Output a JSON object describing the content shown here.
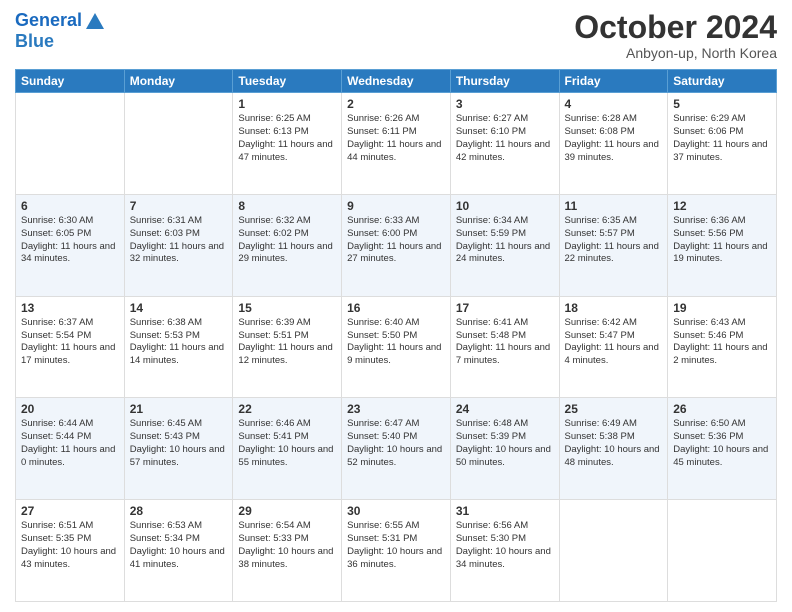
{
  "logo": {
    "line1": "General",
    "line2": "Blue"
  },
  "title": "October 2024",
  "subtitle": "Anbyon-up, North Korea",
  "days_of_week": [
    "Sunday",
    "Monday",
    "Tuesday",
    "Wednesday",
    "Thursday",
    "Friday",
    "Saturday"
  ],
  "weeks": [
    [
      {
        "day": "",
        "info": ""
      },
      {
        "day": "",
        "info": ""
      },
      {
        "day": "1",
        "info": "Sunrise: 6:25 AM\nSunset: 6:13 PM\nDaylight: 11 hours and 47 minutes."
      },
      {
        "day": "2",
        "info": "Sunrise: 6:26 AM\nSunset: 6:11 PM\nDaylight: 11 hours and 44 minutes."
      },
      {
        "day": "3",
        "info": "Sunrise: 6:27 AM\nSunset: 6:10 PM\nDaylight: 11 hours and 42 minutes."
      },
      {
        "day": "4",
        "info": "Sunrise: 6:28 AM\nSunset: 6:08 PM\nDaylight: 11 hours and 39 minutes."
      },
      {
        "day": "5",
        "info": "Sunrise: 6:29 AM\nSunset: 6:06 PM\nDaylight: 11 hours and 37 minutes."
      }
    ],
    [
      {
        "day": "6",
        "info": "Sunrise: 6:30 AM\nSunset: 6:05 PM\nDaylight: 11 hours and 34 minutes."
      },
      {
        "day": "7",
        "info": "Sunrise: 6:31 AM\nSunset: 6:03 PM\nDaylight: 11 hours and 32 minutes."
      },
      {
        "day": "8",
        "info": "Sunrise: 6:32 AM\nSunset: 6:02 PM\nDaylight: 11 hours and 29 minutes."
      },
      {
        "day": "9",
        "info": "Sunrise: 6:33 AM\nSunset: 6:00 PM\nDaylight: 11 hours and 27 minutes."
      },
      {
        "day": "10",
        "info": "Sunrise: 6:34 AM\nSunset: 5:59 PM\nDaylight: 11 hours and 24 minutes."
      },
      {
        "day": "11",
        "info": "Sunrise: 6:35 AM\nSunset: 5:57 PM\nDaylight: 11 hours and 22 minutes."
      },
      {
        "day": "12",
        "info": "Sunrise: 6:36 AM\nSunset: 5:56 PM\nDaylight: 11 hours and 19 minutes."
      }
    ],
    [
      {
        "day": "13",
        "info": "Sunrise: 6:37 AM\nSunset: 5:54 PM\nDaylight: 11 hours and 17 minutes."
      },
      {
        "day": "14",
        "info": "Sunrise: 6:38 AM\nSunset: 5:53 PM\nDaylight: 11 hours and 14 minutes."
      },
      {
        "day": "15",
        "info": "Sunrise: 6:39 AM\nSunset: 5:51 PM\nDaylight: 11 hours and 12 minutes."
      },
      {
        "day": "16",
        "info": "Sunrise: 6:40 AM\nSunset: 5:50 PM\nDaylight: 11 hours and 9 minutes."
      },
      {
        "day": "17",
        "info": "Sunrise: 6:41 AM\nSunset: 5:48 PM\nDaylight: 11 hours and 7 minutes."
      },
      {
        "day": "18",
        "info": "Sunrise: 6:42 AM\nSunset: 5:47 PM\nDaylight: 11 hours and 4 minutes."
      },
      {
        "day": "19",
        "info": "Sunrise: 6:43 AM\nSunset: 5:46 PM\nDaylight: 11 hours and 2 minutes."
      }
    ],
    [
      {
        "day": "20",
        "info": "Sunrise: 6:44 AM\nSunset: 5:44 PM\nDaylight: 11 hours and 0 minutes."
      },
      {
        "day": "21",
        "info": "Sunrise: 6:45 AM\nSunset: 5:43 PM\nDaylight: 10 hours and 57 minutes."
      },
      {
        "day": "22",
        "info": "Sunrise: 6:46 AM\nSunset: 5:41 PM\nDaylight: 10 hours and 55 minutes."
      },
      {
        "day": "23",
        "info": "Sunrise: 6:47 AM\nSunset: 5:40 PM\nDaylight: 10 hours and 52 minutes."
      },
      {
        "day": "24",
        "info": "Sunrise: 6:48 AM\nSunset: 5:39 PM\nDaylight: 10 hours and 50 minutes."
      },
      {
        "day": "25",
        "info": "Sunrise: 6:49 AM\nSunset: 5:38 PM\nDaylight: 10 hours and 48 minutes."
      },
      {
        "day": "26",
        "info": "Sunrise: 6:50 AM\nSunset: 5:36 PM\nDaylight: 10 hours and 45 minutes."
      }
    ],
    [
      {
        "day": "27",
        "info": "Sunrise: 6:51 AM\nSunset: 5:35 PM\nDaylight: 10 hours and 43 minutes."
      },
      {
        "day": "28",
        "info": "Sunrise: 6:53 AM\nSunset: 5:34 PM\nDaylight: 10 hours and 41 minutes."
      },
      {
        "day": "29",
        "info": "Sunrise: 6:54 AM\nSunset: 5:33 PM\nDaylight: 10 hours and 38 minutes."
      },
      {
        "day": "30",
        "info": "Sunrise: 6:55 AM\nSunset: 5:31 PM\nDaylight: 10 hours and 36 minutes."
      },
      {
        "day": "31",
        "info": "Sunrise: 6:56 AM\nSunset: 5:30 PM\nDaylight: 10 hours and 34 minutes."
      },
      {
        "day": "",
        "info": ""
      },
      {
        "day": "",
        "info": ""
      }
    ]
  ]
}
